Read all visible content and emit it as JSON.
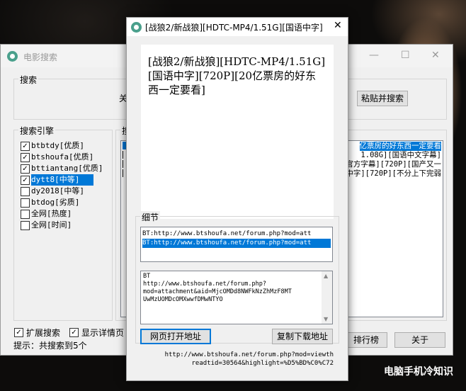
{
  "main_window": {
    "title": "电影搜索",
    "search_group": "搜索",
    "search_text_partial": "关",
    "paste_search_button": "粘贴并搜索",
    "engines_group": "搜索引擎",
    "engines": [
      {
        "label": "btbtdy[优质]",
        "checked": true,
        "selected": false
      },
      {
        "label": "btshoufa[优质]",
        "checked": true,
        "selected": false
      },
      {
        "label": "bttiantang[优质]",
        "checked": true,
        "selected": false
      },
      {
        "label": "dytt8[中等]",
        "checked": true,
        "selected": true
      },
      {
        "label": "dy2018[中等]",
        "checked": false,
        "selected": false
      },
      {
        "label": "btdog[劣质]",
        "checked": false,
        "selected": false
      },
      {
        "label": "全网[热度]",
        "checked": false,
        "selected": false
      },
      {
        "label": "全网[时间]",
        "checked": false,
        "selected": false
      }
    ],
    "results_group_partial": "搜",
    "results": [
      {
        "text": "亿票房的好东西一定要看",
        "selected": true
      },
      {
        "text": "1.08G][国语中文字幕]",
        "selected": false
      },
      {
        "text": "官方字幕][720P][国产又一",
        "selected": false
      },
      {
        "text": "中字][720P][不分上下完弱",
        "selected": false
      }
    ],
    "expand_search_label": "扩展搜索",
    "show_detail_label": "显示详情页",
    "status": "提示：共搜索到5个",
    "ranking_button": "排行榜",
    "about_button": "关于"
  },
  "detail_window": {
    "title": "[战狼2/新战狼][HDTC-MP4/1.51G][国语中字]...",
    "heading_text": "[战狼2/新战狼][HDTC-MP4/1.51G][国语中字][720P][20亿票房的好东西一定要看]",
    "details_group": "细节",
    "links": [
      {
        "text": "BT:http://www.btshoufa.net/forum.php?mod=att",
        "selected": false
      },
      {
        "text": "BT:http://www.btshoufa.net/forum.php?mod=att",
        "selected": true
      }
    ],
    "detail_text": "BT\nhttp://www.btshoufa.net/forum.php?\nmod=attachment&aid=MjcOMDd8NWFkNzZhMzF8MT\nUwMzUOMDcOMXwwfDMwNTYO",
    "open_button": "网页打开地址",
    "copy_button": "复制下载地址",
    "footer_url": "http://www.btshoufa.net/forum.php?mod=viewth\nreadtid=30564&highlight=%D5%BD%C0%C72"
  },
  "watermark": "电脑手机冷知识",
  "icons": {
    "app": "film-reel-icon",
    "close": "close-icon",
    "minimize": "minimize-icon",
    "maximize": "maximize-icon",
    "check": "checkmark-icon",
    "scroll_up": "scroll-up-icon",
    "scroll_down": "scroll-down-icon"
  },
  "colors": {
    "selection": "#0078d7",
    "window_bg": "#f0f0f0",
    "default_button_border": "#0078d7"
  }
}
